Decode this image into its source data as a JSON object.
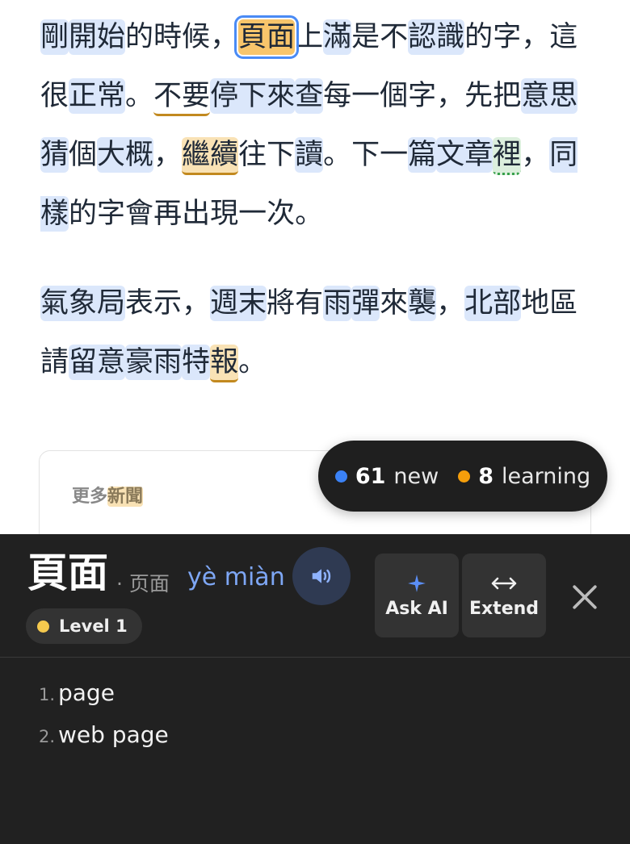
{
  "passage": {
    "paragraph1": [
      {
        "t": "剛",
        "k": "new"
      },
      {
        "t": "開始",
        "k": "new"
      },
      {
        "t": "的",
        "k": "plain"
      },
      {
        "t": "時候",
        "k": "plain"
      },
      {
        "t": "，",
        "k": "plain"
      },
      {
        "t": "頁面",
        "k": "selected"
      },
      {
        "t": "上",
        "k": "plain"
      },
      {
        "t": "滿",
        "k": "new"
      },
      {
        "t": "是",
        "k": "plain"
      },
      {
        "t": "不",
        "k": "plain"
      },
      {
        "t": "認識",
        "k": "new"
      },
      {
        "t": "的",
        "k": "plain"
      },
      {
        "t": "字",
        "k": "plain"
      },
      {
        "t": "，",
        "k": "plain"
      },
      {
        "t": "這",
        "k": "plain"
      },
      {
        "t": "很",
        "k": "plain"
      },
      {
        "t": "正常",
        "k": "new"
      },
      {
        "t": "。",
        "k": "plain"
      },
      {
        "t": "不要",
        "k": "underline"
      },
      {
        "t": "停下來",
        "k": "new"
      },
      {
        "t": "查",
        "k": "new"
      },
      {
        "t": "每",
        "k": "plain"
      },
      {
        "t": "一",
        "k": "plain"
      },
      {
        "t": "個",
        "k": "plain"
      },
      {
        "t": "字",
        "k": "plain"
      },
      {
        "t": "，",
        "k": "plain"
      },
      {
        "t": "先",
        "k": "plain"
      },
      {
        "t": "把",
        "k": "plain"
      },
      {
        "t": "意思",
        "k": "new"
      },
      {
        "t": "猜",
        "k": "new"
      },
      {
        "t": "個",
        "k": "plain"
      },
      {
        "t": "大概",
        "k": "new"
      },
      {
        "t": "，",
        "k": "plain"
      },
      {
        "t": "繼續",
        "k": "learning"
      },
      {
        "t": "往",
        "k": "plain"
      },
      {
        "t": "下",
        "k": "plain"
      },
      {
        "t": "讀",
        "k": "new"
      },
      {
        "t": "。",
        "k": "plain"
      },
      {
        "t": "下",
        "k": "plain"
      },
      {
        "t": "一",
        "k": "plain"
      },
      {
        "t": "篇",
        "k": "new"
      },
      {
        "t": "文章",
        "k": "new"
      },
      {
        "t": "裡",
        "k": "known"
      },
      {
        "t": "，",
        "k": "plain"
      },
      {
        "t": "同樣",
        "k": "new"
      },
      {
        "t": "的",
        "k": "plain"
      },
      {
        "t": "字",
        "k": "plain"
      },
      {
        "t": "會",
        "k": "plain"
      },
      {
        "t": "再",
        "k": "plain"
      },
      {
        "t": "出現",
        "k": "plain"
      },
      {
        "t": "一",
        "k": "plain"
      },
      {
        "t": "次",
        "k": "plain"
      },
      {
        "t": "。",
        "k": "plain"
      }
    ],
    "paragraph2": [
      {
        "t": "氣象局",
        "k": "new"
      },
      {
        "t": "表示",
        "k": "plain"
      },
      {
        "t": "，",
        "k": "plain"
      },
      {
        "t": "週末",
        "k": "new"
      },
      {
        "t": "將",
        "k": "plain"
      },
      {
        "t": "有",
        "k": "plain"
      },
      {
        "t": "雨",
        "k": "new"
      },
      {
        "t": "彈",
        "k": "new"
      },
      {
        "t": "來",
        "k": "plain"
      },
      {
        "t": "襲",
        "k": "new"
      },
      {
        "t": "，",
        "k": "plain"
      },
      {
        "t": "北部",
        "k": "new"
      },
      {
        "t": "地",
        "k": "plain"
      },
      {
        "t": "區",
        "k": "plain"
      },
      {
        "t": "請",
        "k": "plain"
      },
      {
        "t": "留意",
        "k": "new"
      },
      {
        "t": "豪雨",
        "k": "new"
      },
      {
        "t": "特",
        "k": "new"
      },
      {
        "t": "報",
        "k": "learning"
      },
      {
        "t": "。",
        "k": "plain"
      }
    ]
  },
  "news_card": {
    "title_prefix": "更多",
    "title_highlight": "新聞"
  },
  "stats": {
    "new_count": "61",
    "new_label": "new",
    "learning_count": "8",
    "learning_label": "learning",
    "new_color": "#3b82f6",
    "learning_color": "#f59e0b"
  },
  "dictionary": {
    "headword": "頁面",
    "simplified": "· 页面",
    "pinyin": "yè miàn",
    "speaker_icon": "speaker-icon",
    "level_label": "Level 1",
    "level_color": "#f5c94e",
    "ask_ai_label": "Ask AI",
    "extend_label": "Extend",
    "definitions": [
      {
        "num": "1.",
        "text": "page"
      },
      {
        "num": "2.",
        "text": "web page"
      }
    ]
  }
}
